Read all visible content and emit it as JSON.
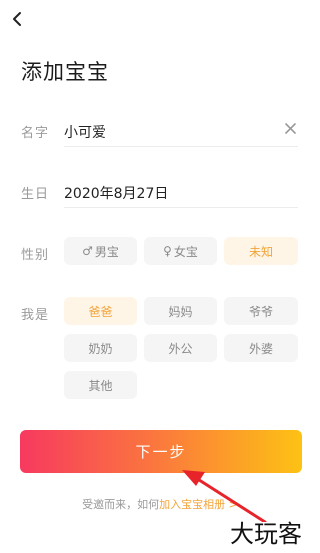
{
  "header": {
    "back_icon": "chevron-left-icon"
  },
  "page": {
    "title": "添加宝宝"
  },
  "form": {
    "name": {
      "label": "名字",
      "value": "小可爱",
      "clear_icon": "close-icon"
    },
    "birthday": {
      "label": "生日",
      "value": "2020年8月27日"
    },
    "gender": {
      "label": "性别",
      "options": [
        {
          "label": "男宝",
          "icon": "male-symbol-icon",
          "symbol": "♂",
          "selected": false
        },
        {
          "label": "女宝",
          "icon": "female-symbol-icon",
          "symbol": "♀",
          "selected": false
        },
        {
          "label": "未知",
          "selected": true
        }
      ]
    },
    "relation": {
      "label": "我是",
      "options": [
        {
          "label": "爸爸",
          "selected": true
        },
        {
          "label": "妈妈",
          "selected": false
        },
        {
          "label": "爷爷",
          "selected": false
        },
        {
          "label": "奶奶",
          "selected": false
        },
        {
          "label": "外公",
          "selected": false
        },
        {
          "label": "外婆",
          "selected": false
        },
        {
          "label": "其他",
          "selected": false
        }
      ]
    }
  },
  "actions": {
    "next_label": "下一步"
  },
  "footer": {
    "prefix": "受邀而来，如何",
    "link": "加入宝宝相册",
    "suffix": " >"
  },
  "watermark": {
    "text": "大玩客"
  },
  "colors": {
    "accent": "#f2a43a",
    "selected_bg": "#fff5e6",
    "chip_bg": "#f5f5f5",
    "gradient_start": "#f7395f",
    "gradient_end": "#fdc214",
    "annotation_arrow": "#e8242b"
  }
}
